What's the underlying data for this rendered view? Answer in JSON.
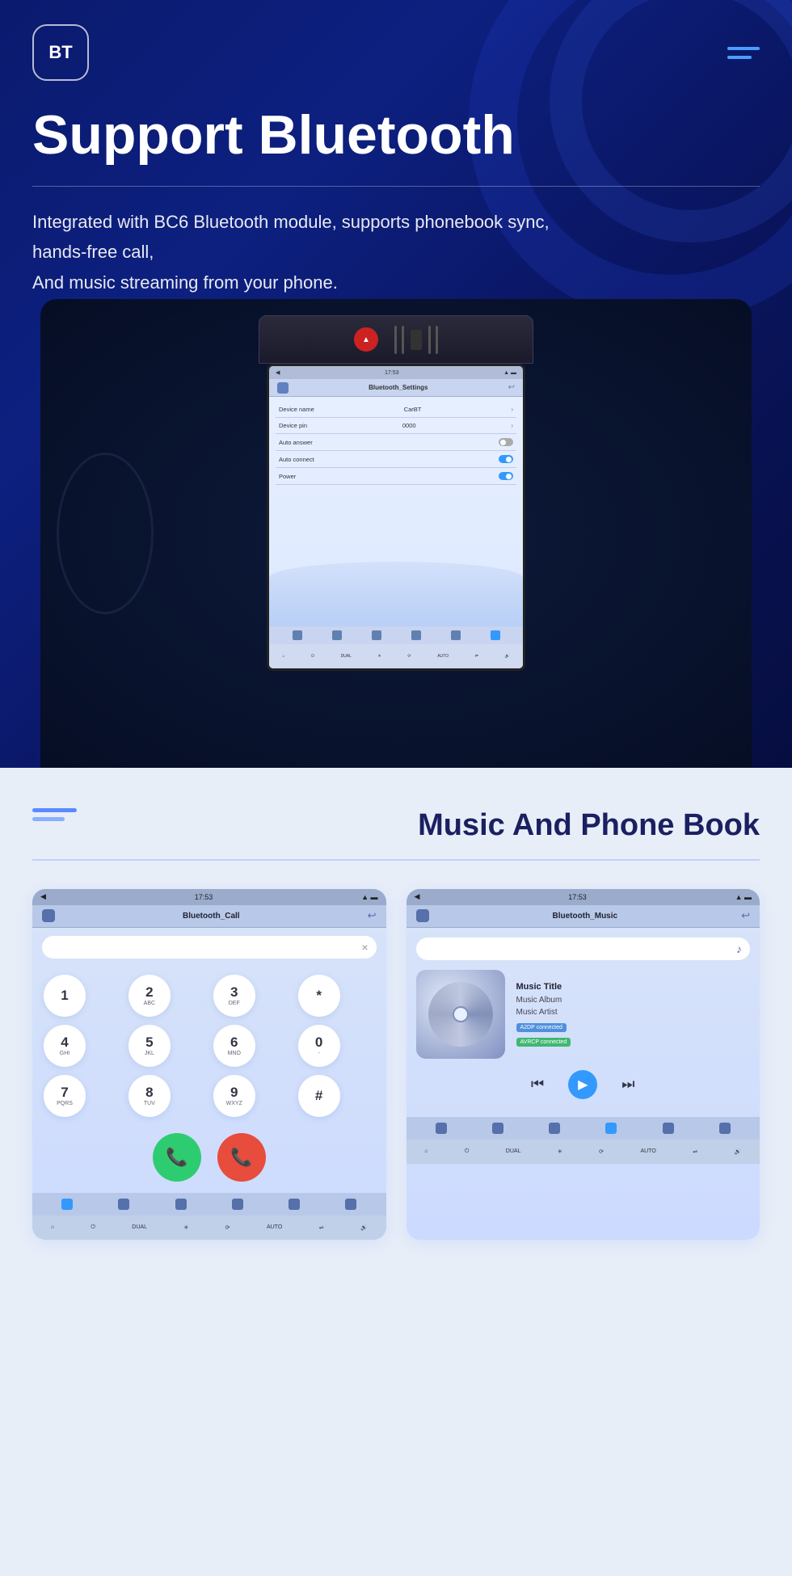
{
  "hero": {
    "bt_logo": "BT",
    "menu_label": "menu",
    "title": "Support Bluetooth",
    "divider": "",
    "description_line1": "Integrated with BC6 Bluetooth module, supports phonebook sync, hands-free call,",
    "description_line2": "And music streaming from your phone."
  },
  "screen": {
    "status_time": "17:53",
    "title": "Bluetooth_Settings",
    "rows": [
      {
        "label": "Device name",
        "value": "CarBT",
        "type": "arrow"
      },
      {
        "label": "Device pin",
        "value": "0000",
        "type": "arrow"
      },
      {
        "label": "Auto answer",
        "value": "",
        "type": "toggle_off"
      },
      {
        "label": "Auto connect",
        "value": "",
        "type": "toggle_on"
      },
      {
        "label": "Power",
        "value": "",
        "type": "toggle_on"
      }
    ]
  },
  "bottom_section": {
    "section_title": "Music And Phone Book",
    "left_panel": {
      "status_time": "17:53",
      "title": "Bluetooth_Call",
      "dial_keys": [
        {
          "num": "1",
          "sub": ""
        },
        {
          "num": "2",
          "sub": "ABC"
        },
        {
          "num": "3",
          "sub": "DEF"
        },
        {
          "num": "*",
          "sub": ""
        },
        {
          "num": "4",
          "sub": "GHI"
        },
        {
          "num": "5",
          "sub": "JKL"
        },
        {
          "num": "6",
          "sub": "MNO"
        },
        {
          "num": "0",
          "sub": "-"
        },
        {
          "num": "7",
          "sub": "PQRS"
        },
        {
          "num": "8",
          "sub": "TUV"
        },
        {
          "num": "9",
          "sub": "WXYZ"
        },
        {
          "num": "#",
          "sub": ""
        }
      ]
    },
    "right_panel": {
      "status_time": "17:53",
      "title": "Bluetooth_Music",
      "music_title": "Music Title",
      "music_album": "Music Album",
      "music_artist": "Music Artist",
      "badge1": "A2DP connected",
      "badge2": "AVRCP connected"
    }
  }
}
